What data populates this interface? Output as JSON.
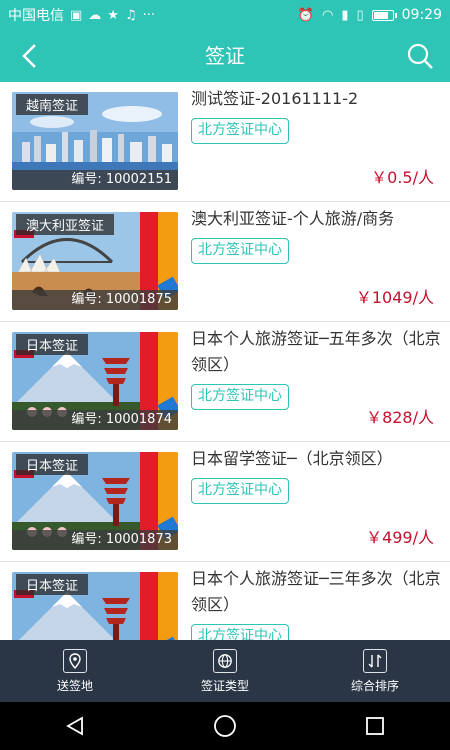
{
  "status_bar": {
    "carrier": "中国电信",
    "time": "09:29",
    "battery_level": 0.8
  },
  "nav": {
    "title": "签证",
    "back_icon": "back-arrow-icon",
    "search_icon": "search-icon"
  },
  "items": [
    {
      "thumb_tag": "越南签证",
      "code": "编号: 10002151",
      "title": "测试签证-20161111-2",
      "center": "北方签证中心",
      "price": "￥0.5/人",
      "scene": "city"
    },
    {
      "thumb_tag": "澳大利亚签证",
      "code": "编号: 10001875",
      "title": "澳大利亚签证-个人旅游/商务",
      "center": "北方签证中心",
      "price": "￥1049/人",
      "scene": "australia"
    },
    {
      "thumb_tag": "日本签证",
      "code": "编号: 10001874",
      "title": "日本个人旅游签证─五年多次（北京领区）",
      "center": "北方签证中心",
      "price": "￥828/人",
      "scene": "japan"
    },
    {
      "thumb_tag": "日本签证",
      "code": "编号: 10001873",
      "title": "日本留学签证─（北京领区）",
      "center": "北方签证中心",
      "price": "￥499/人",
      "scene": "japan"
    },
    {
      "thumb_tag": "日本签证",
      "code": "",
      "title": "日本个人旅游签证─三年多次（北京领区）",
      "center": "北方签证中心",
      "price": "",
      "scene": "japan"
    }
  ],
  "tabs": [
    {
      "label": "送签地",
      "icon": "location-icon"
    },
    {
      "label": "签证类型",
      "icon": "globe-icon"
    },
    {
      "label": "综合排序",
      "icon": "sort-icon"
    }
  ],
  "system_nav": {
    "back": "back-triangle-icon",
    "home": "home-circle-icon",
    "recent": "recent-square-icon"
  },
  "colors": {
    "accent": "#2ec4b6",
    "price": "#c8102e",
    "tabbar": "#2a3545"
  }
}
